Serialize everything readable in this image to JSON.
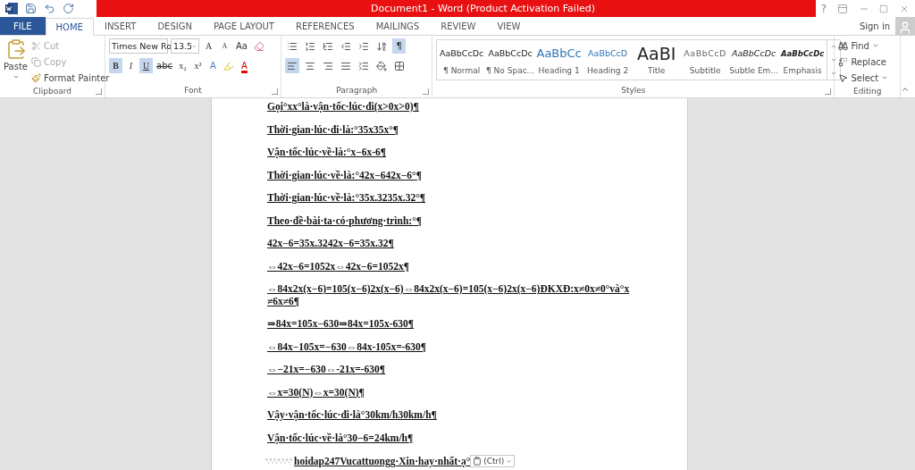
{
  "window": {
    "title": "Document1 - Word (Product Activation Failed)",
    "sign_in": "Sign in",
    "help": "?"
  },
  "tabs": [
    {
      "label": "FILE",
      "selected": false,
      "kind": "file"
    },
    {
      "label": "HOME",
      "selected": true,
      "kind": "tab"
    },
    {
      "label": "INSERT",
      "selected": false,
      "kind": "tab"
    },
    {
      "label": "DESIGN",
      "selected": false,
      "kind": "tab"
    },
    {
      "label": "PAGE LAYOUT",
      "selected": false,
      "kind": "tab"
    },
    {
      "label": "REFERENCES",
      "selected": false,
      "kind": "tab"
    },
    {
      "label": "MAILINGS",
      "selected": false,
      "kind": "tab"
    },
    {
      "label": "REVIEW",
      "selected": false,
      "kind": "tab"
    },
    {
      "label": "VIEW",
      "selected": false,
      "kind": "tab"
    }
  ],
  "clipboard": {
    "label": "Clipboard",
    "paste": "Paste",
    "cut": "Cut",
    "copy": "Copy",
    "format_painter": "Format Painter"
  },
  "font": {
    "label": "Font",
    "name": "Times New Ro",
    "size": "13.5",
    "grow": "A",
    "shrink": "A",
    "case": "Aa",
    "toggles": [
      {
        "label": "B",
        "selected": true,
        "kind": "bold"
      },
      {
        "label": "I",
        "selected": false,
        "kind": "italic"
      },
      {
        "label": "U",
        "selected": true,
        "kind": "underline"
      },
      {
        "label": "abc",
        "selected": false,
        "kind": "strike"
      },
      {
        "label": "x₂",
        "selected": false,
        "kind": "plain"
      },
      {
        "label": "x²",
        "selected": false,
        "kind": "plain"
      }
    ],
    "effects": "A",
    "font_color": "A"
  },
  "paragraph": {
    "label": "Paragraph",
    "pilcrow": {
      "label": "¶",
      "selected": true
    },
    "align": [
      {
        "kind": "left",
        "selected": true
      },
      {
        "kind": "center",
        "selected": false
      },
      {
        "kind": "right",
        "selected": false
      },
      {
        "kind": "justify",
        "selected": false
      }
    ]
  },
  "styles": {
    "label": "Styles",
    "items": [
      {
        "preview": "AaBbCcDc",
        "name": "¶ Normal",
        "kind": "normal"
      },
      {
        "preview": "AaBbCcDc",
        "name": "¶ No Spac...",
        "kind": "normal"
      },
      {
        "preview": "AaBbCc",
        "name": "Heading 1",
        "kind": "heading1"
      },
      {
        "preview": "AaBbCcD",
        "name": "Heading 2",
        "kind": "heading2"
      },
      {
        "preview": "AaBI",
        "name": "Title",
        "kind": "title"
      },
      {
        "preview": "AaBbCcD",
        "name": "Subtitle",
        "kind": "subtitle"
      },
      {
        "preview": "AaBbCcDc",
        "name": "Subtle Em...",
        "kind": "subtle"
      },
      {
        "preview": "AaBbCcDc",
        "name": "Emphasis",
        "kind": "emphasis"
      }
    ]
  },
  "editing": {
    "label": "Editing",
    "find": "Find",
    "replace": "Replace",
    "select": "Select"
  },
  "document": {
    "paragraphs": [
      {
        "text": "Gọi°xx°là·vận·tốc·lúc·đi(x>0x>0)¶"
      },
      {
        "text": "Thời·gian·lúc·đi·là:°35x35x°¶"
      },
      {
        "text": "Vận·tốc·lúc·về·là:°x−6x-6¶"
      },
      {
        "text": "Thời·gian·lúc·về·là:°42x−642x−6°¶"
      },
      {
        "text": "Thời·gian·lúc·về·là:°35x.3235x.32°¶"
      },
      {
        "text": "Theo·đề·bài·ta·có·phương·trình:°¶"
      },
      {
        "text": "42x−6=35x.3242x−6=35x.32¶"
      },
      {
        "text": "⇔42x−6=1052x⇔42x−6=1052x¶"
      },
      {
        "text": "⇔84x2x(x−6)=105(x−6)2x(x−6)⇔84x2x(x−6)=105(x−6)2x(x−6)ĐKXĐ:x≠0x≠0°và°x ≠6x≠6¶"
      },
      {
        "text": "⇒84x=105x−630⇒84x=105x-630¶"
      },
      {
        "text": "⇔84x−105x=−630⇔84x-105x=-630¶"
      },
      {
        "text": "⇔−21x=−630⇔-21x=-630¶"
      },
      {
        "text": "⇔x=30(N)⇔x=30(N)¶"
      },
      {
        "text": "Vậy·vận·tốc·lúc·đi·là°30km/h30km/h¶"
      },
      {
        "text": "Vận·tốc·lúc·về·là°30−6=24km/h¶"
      }
    ],
    "last_line": {
      "marks": "°,°,°,°,°,°,°",
      "text": "hoidap247Vucattuongg·Xin·hay·nhất·ạ°",
      "paste_options": "(Ctrl)"
    }
  }
}
